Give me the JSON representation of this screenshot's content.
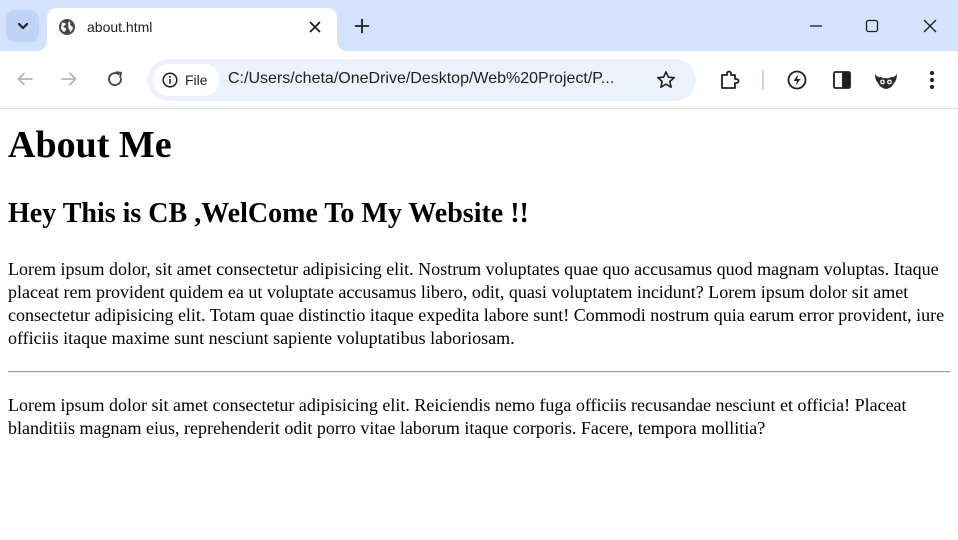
{
  "tabstrip": {
    "tab_search_icon": "chevron-down-icon",
    "active_tab": {
      "title": "about.html",
      "favicon": "globe-icon",
      "close_icon": "close-icon"
    },
    "new_tab_icon": "plus-icon",
    "window_controls": [
      "minimize-icon",
      "maximize-icon",
      "close-icon"
    ]
  },
  "toolbar": {
    "back_icon": "back-arrow-icon",
    "forward_icon": "forward-arrow-icon",
    "reload_icon": "reload-icon",
    "site_chip": {
      "icon": "info-icon",
      "label": "File"
    },
    "url": "C:/Users/cheta/OneDrive/Desktop/Web%20Project/P...",
    "bookmark_icon": "star-icon",
    "extensions_icon": "puzzle-icon",
    "performance_icon": "lightning-icon",
    "side_panel_icon": "side-panel-icon",
    "profile_icon": "profile-avatar-icon",
    "menu_icon": "more-vertical-icon"
  },
  "page": {
    "heading": "About Me",
    "subheading": "Hey This is CB ,WelCome To My Website !!",
    "paragraph1": "Lorem ipsum dolor, sit amet consectetur adipisicing elit. Nostrum voluptates quae quo accusamus quod magnam voluptas. Itaque placeat rem provident quidem ea ut voluptate accusamus libero, odit, quasi voluptatem incidunt? Lorem ipsum dolor sit amet consectetur adipisicing elit. Totam quae distinctio itaque expedita labore sunt! Commodi nostrum quia earum error provident, iure officiis itaque maxime sunt nesciunt sapiente voluptatibus laboriosam.",
    "paragraph2": "Lorem ipsum dolor sit amet consectetur adipisicing elit. Reiciendis nemo fuga officiis recusandae nesciunt et officia! Placeat blanditiis magnam eius, reprehenderit odit porro vitae laborum itaque corporis. Facere, tempora mollitia?"
  },
  "colors": {
    "tabstrip_bg": "#d3e3fd",
    "omnibox_bg": "#edf2fa",
    "icon": "#474747"
  }
}
